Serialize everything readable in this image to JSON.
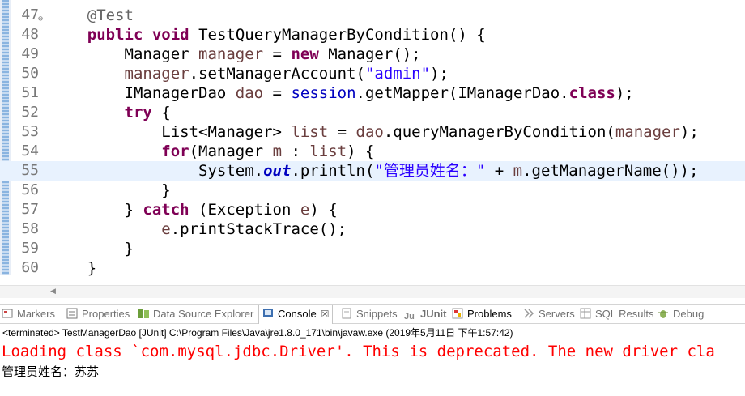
{
  "editor": {
    "lines": [
      {
        "num": "47",
        "fold": true,
        "parts": [
          {
            "t": "    "
          },
          {
            "t": "@Test",
            "c": "ann"
          }
        ]
      },
      {
        "num": "48",
        "parts": [
          {
            "t": "    "
          },
          {
            "t": "public",
            "c": "kw"
          },
          {
            "t": " "
          },
          {
            "t": "void",
            "c": "kw"
          },
          {
            "t": " TestQueryManagerByCondition() {"
          }
        ]
      },
      {
        "num": "49",
        "parts": [
          {
            "t": "        Manager "
          },
          {
            "t": "manager",
            "c": "var"
          },
          {
            "t": " = "
          },
          {
            "t": "new",
            "c": "kw"
          },
          {
            "t": " Manager();"
          }
        ]
      },
      {
        "num": "50",
        "parts": [
          {
            "t": "        "
          },
          {
            "t": "manager",
            "c": "var"
          },
          {
            "t": ".setManagerAccount("
          },
          {
            "t": "\"admin\"",
            "c": "str"
          },
          {
            "t": ");"
          }
        ]
      },
      {
        "num": "51",
        "parts": [
          {
            "t": "        IManagerDao "
          },
          {
            "t": "dao",
            "c": "var"
          },
          {
            "t": " = "
          },
          {
            "t": "session",
            "c": "fld"
          },
          {
            "t": ".getMapper(IManagerDao."
          },
          {
            "t": "class",
            "c": "kw"
          },
          {
            "t": ");"
          }
        ]
      },
      {
        "num": "52",
        "parts": [
          {
            "t": "        "
          },
          {
            "t": "try",
            "c": "kw"
          },
          {
            "t": " {"
          }
        ]
      },
      {
        "num": "53",
        "parts": [
          {
            "t": "            List<Manager> "
          },
          {
            "t": "list",
            "c": "var"
          },
          {
            "t": " = "
          },
          {
            "t": "dao",
            "c": "var"
          },
          {
            "t": ".queryManagerByCondition("
          },
          {
            "t": "manager",
            "c": "var"
          },
          {
            "t": ");"
          }
        ]
      },
      {
        "num": "54",
        "parts": [
          {
            "t": "            "
          },
          {
            "t": "for",
            "c": "kw"
          },
          {
            "t": "(Manager "
          },
          {
            "t": "m",
            "c": "var"
          },
          {
            "t": " : "
          },
          {
            "t": "list",
            "c": "var"
          },
          {
            "t": ") {"
          }
        ]
      },
      {
        "num": "55",
        "current": true,
        "parts": [
          {
            "t": "                System."
          },
          {
            "t": "out",
            "c": "fld-it"
          },
          {
            "t": ".println("
          },
          {
            "t": "\"管理员姓名：\"",
            "c": "str"
          },
          {
            "t": " + "
          },
          {
            "t": "m",
            "c": "var"
          },
          {
            "t": ".getManagerName());"
          }
        ]
      },
      {
        "num": "56",
        "parts": [
          {
            "t": "            }"
          }
        ]
      },
      {
        "num": "57",
        "parts": [
          {
            "t": "        } "
          },
          {
            "t": "catch",
            "c": "kw"
          },
          {
            "t": " (Exception "
          },
          {
            "t": "e",
            "c": "var"
          },
          {
            "t": ") {"
          }
        ]
      },
      {
        "num": "58",
        "parts": [
          {
            "t": "            "
          },
          {
            "t": "e",
            "c": "var"
          },
          {
            "t": ".printStackTrace();"
          }
        ]
      },
      {
        "num": "59",
        "parts": [
          {
            "t": "        }"
          }
        ]
      },
      {
        "num": "60",
        "parts": [
          {
            "t": "    }"
          }
        ]
      }
    ]
  },
  "tabs": [
    {
      "name": "markers",
      "label": "Markers",
      "icon": "markers-icon"
    },
    {
      "name": "properties",
      "label": "Properties",
      "icon": "properties-icon"
    },
    {
      "name": "data-source-explorer",
      "label": "Data Source Explorer",
      "icon": "database-icon"
    },
    {
      "name": "console",
      "label": "Console",
      "icon": "console-icon",
      "active": true
    },
    {
      "name": "snippets",
      "label": "Snippets",
      "icon": "snippets-icon"
    },
    {
      "name": "junit",
      "label": "JUnit",
      "icon": "junit-icon"
    },
    {
      "name": "problems",
      "label": "Problems",
      "icon": "problems-icon"
    },
    {
      "name": "servers",
      "label": "Servers",
      "icon": "servers-icon"
    },
    {
      "name": "sql-results",
      "label": "SQL Results",
      "icon": "sql-results-icon"
    },
    {
      "name": "debug",
      "label": "Debug",
      "icon": "debug-icon"
    }
  ],
  "console": {
    "header": "<terminated> TestManagerDao [JUnit] C:\\Program Files\\Java\\jre1.8.0_171\\bin\\javaw.exe (2019年5月11日 下午1:57:42)",
    "error_line": "Loading class `com.mysql.jdbc.Driver'. This is deprecated. The new driver cla",
    "output_line": "管理员姓名：苏苏"
  },
  "colors": {
    "keyword": "#7f0055",
    "string": "#2a00ff",
    "field": "#0000c0",
    "local_variable": "#6a3e3e",
    "annotation": "#646464",
    "stderr": "#ff0000",
    "current_line": "#e8f2fe"
  }
}
